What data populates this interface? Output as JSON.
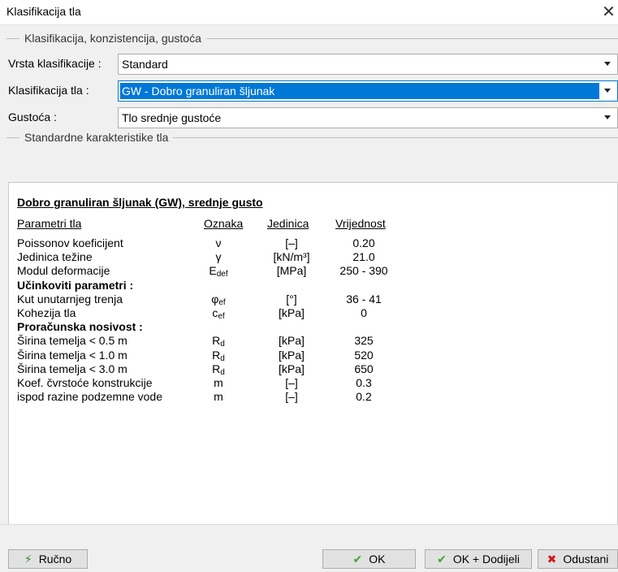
{
  "window": {
    "title": "Klasifikacija tla",
    "close_glyph": "✕"
  },
  "groups": {
    "classification": "Klasifikacija, konzistencija, gustoća",
    "characteristics": "Standardne karakteristike tla"
  },
  "fields": {
    "vrsta_label": "Vrsta klasifikacije :",
    "vrsta_value": "Standard",
    "klasifikacija_label": "Klasifikacija tla :",
    "klasifikacija_value": "GW - Dobro granuliran šljunak",
    "gustoca_label": "Gustoća :",
    "gustoca_value": "Tlo srednje gustoće"
  },
  "panel": {
    "title": "Dobro granuliran šljunak (GW), srednje gusto",
    "headers": [
      "Parametri tla",
      "Oznaka",
      "Jedinica",
      "Vrijednost"
    ],
    "rows": [
      {
        "name": "Poissonov koeficijent",
        "symbol": "ν",
        "sub": "",
        "unit": "[–]",
        "value": "0.20"
      },
      {
        "name": "Jedinica težine",
        "symbol": "γ",
        "sub": "",
        "unit": "[kN/m³]",
        "value": "21.0"
      },
      {
        "name": "Modul deformacije",
        "symbol": "E",
        "sub": "def",
        "unit": "[MPa]",
        "value": "250 - 390"
      },
      {
        "name": "Učinkoviti parametri :",
        "section": true
      },
      {
        "name": "Kut unutarnjeg trenja",
        "symbol": "φ",
        "sub": "ef",
        "unit": "[°]",
        "value": "36 - 41"
      },
      {
        "name": "Kohezija tla",
        "symbol": "c",
        "sub": "ef",
        "unit": "[kPa]",
        "value": "0"
      },
      {
        "name": "Proračunska nosivost :",
        "section": true
      },
      {
        "name": "Širina temelja < 0.5 m",
        "symbol": "R",
        "sub": "d",
        "unit": "[kPa]",
        "value": "325"
      },
      {
        "name": "Širina temelja < 1.0 m",
        "symbol": "R",
        "sub": "d",
        "unit": "[kPa]",
        "value": "520"
      },
      {
        "name": "Širina temelja < 3.0 m",
        "symbol": "R",
        "sub": "d",
        "unit": "[kPa]",
        "value": "650"
      },
      {
        "name": "Koef. čvrstoće konstrukcije",
        "symbol": "m",
        "sub": "",
        "unit": "[–]",
        "value": "0.3"
      },
      {
        "name": "ispod razine podzemne vode",
        "symbol": "m",
        "sub": "",
        "unit": "[–]",
        "value": "0.2"
      }
    ]
  },
  "buttons": {
    "rucno": "Ručno",
    "ok": "OK",
    "ok_dodijeli": "OK + Dodijeli",
    "odustani": "Odustani"
  },
  "icons": {
    "bolt": "lightning-icon",
    "check": "checkmark-icon",
    "cross": "cross-icon"
  },
  "colors": {
    "selection": "#0078d7",
    "check": "#3ea43a",
    "cross": "#d11b1b"
  }
}
